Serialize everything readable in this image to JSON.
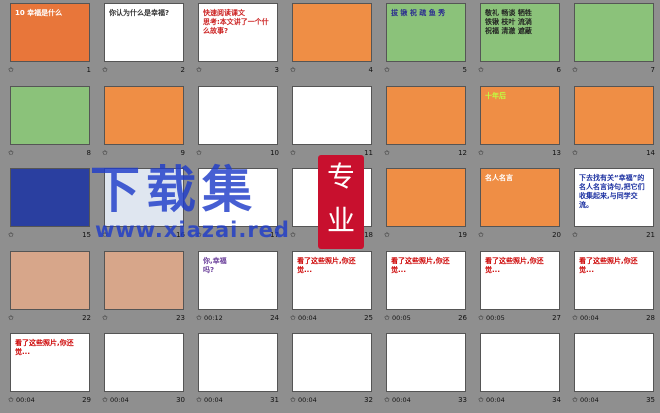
{
  "colors": {
    "background": "#8f8f8f",
    "watermark_blue": "#1e3cc8",
    "seal_red": "#c8102e"
  },
  "watermark": {
    "title": "下载集",
    "seal": "专业",
    "url": "www.xiazai.red"
  },
  "slides": [
    {
      "number": "1",
      "time": "",
      "has_time": false,
      "bg": "#e8763a",
      "text": "10 幸福是什么",
      "text_color": "#ffffff"
    },
    {
      "number": "2",
      "time": "",
      "has_time": false,
      "bg": "#ffffff",
      "text": "你认为什么是幸福?",
      "text_color": "#333333"
    },
    {
      "number": "3",
      "time": "",
      "has_time": false,
      "bg": "#ffffff",
      "text": "快速阅读课文\n思考:本文讲了一个什么故事?",
      "text_color": "#cc2222"
    },
    {
      "number": "4",
      "time": "",
      "has_time": false,
      "bg": "#ef8e45",
      "text": "",
      "text_color": "#ffffff"
    },
    {
      "number": "5",
      "time": "",
      "has_time": false,
      "bg": "#8bc27a",
      "text": "拔 锹 祝 疏 鱼 秀",
      "text_color": "#2a2a90"
    },
    {
      "number": "6",
      "time": "",
      "has_time": false,
      "bg": "#8bc27a",
      "text": "敬礼 畅谈 牺牲\n铁锹 枝叶 流淌\n祝福 清澈 遮蔽",
      "text_color": "#222222"
    },
    {
      "number": "7",
      "time": "",
      "has_time": false,
      "bg": "#8bc27a",
      "text": "",
      "text_color": "#222222"
    },
    {
      "number": "8",
      "time": "",
      "has_time": false,
      "bg": "#8bc27a",
      "text": "",
      "text_color": "#222222"
    },
    {
      "number": "9",
      "time": "",
      "has_time": false,
      "bg": "#ef8e45",
      "text": "",
      "text_color": "#ffffff"
    },
    {
      "number": "10",
      "time": "",
      "has_time": false,
      "bg": "#ffffff",
      "text": "",
      "text_color": "#222222"
    },
    {
      "number": "11",
      "time": "",
      "has_time": false,
      "bg": "#ffffff",
      "text": "",
      "text_color": "#222222"
    },
    {
      "number": "12",
      "time": "",
      "has_time": false,
      "bg": "#ef8e45",
      "text": "",
      "text_color": "#ffffff"
    },
    {
      "number": "13",
      "time": "",
      "has_time": false,
      "bg": "#ef8e45",
      "text": "十年后",
      "text_color": "#c0ff40"
    },
    {
      "number": "14",
      "time": "",
      "has_time": false,
      "bg": "#ef8e45",
      "text": "",
      "text_color": "#ffffff"
    },
    {
      "number": "15",
      "time": "",
      "has_time": false,
      "bg": "#2a3fa0",
      "text": "",
      "text_color": "#ffff66"
    },
    {
      "number": "16",
      "time": "",
      "has_time": false,
      "bg": "#dfe6f0",
      "text": "",
      "text_color": "#222222"
    },
    {
      "number": "17",
      "time": "",
      "has_time": false,
      "bg": "#ffffff",
      "text": "",
      "text_color": "#222222"
    },
    {
      "number": "18",
      "time": "",
      "has_time": false,
      "bg": "#ffffff",
      "text": "",
      "text_color": "#222222"
    },
    {
      "number": "19",
      "time": "",
      "has_time": false,
      "bg": "#ef8e45",
      "text": "",
      "text_color": "#ffffff"
    },
    {
      "number": "20",
      "time": "",
      "has_time": false,
      "bg": "#ef8e45",
      "text": "名人名言",
      "text_color": "#ffffff"
    },
    {
      "number": "21",
      "time": "",
      "has_time": false,
      "bg": "#ffffff",
      "text": "下去找有关“幸福”的名人名言诗句,把它们收集起来,与同学交流。",
      "text_color": "#1a2fa0"
    },
    {
      "number": "22",
      "time": "",
      "has_time": false,
      "bg": "#d7a68a",
      "text": "",
      "text_color": "#ffffff"
    },
    {
      "number": "23",
      "time": "",
      "has_time": false,
      "bg": "#d7a68a",
      "text": "",
      "text_color": "#ffffff"
    },
    {
      "number": "24",
      "time": "00:12",
      "has_time": true,
      "bg": "#ffffff",
      "text": "你,幸福\n吗?",
      "text_color": "#6a3f9a"
    },
    {
      "number": "25",
      "time": "00:04",
      "has_time": true,
      "bg": "#ffffff",
      "text": "看了这些照片,你还觉...",
      "text_color": "#cc0000"
    },
    {
      "number": "26",
      "time": "00:05",
      "has_time": true,
      "bg": "#ffffff",
      "text": "看了这些照片,你还觉...",
      "text_color": "#cc0000"
    },
    {
      "number": "27",
      "time": "00:05",
      "has_time": true,
      "bg": "#ffffff",
      "text": "看了这些照片,你还觉...",
      "text_color": "#cc0000"
    },
    {
      "number": "28",
      "time": "00:04",
      "has_time": true,
      "bg": "#ffffff",
      "text": "看了这些照片,你还觉...",
      "text_color": "#cc0000"
    },
    {
      "number": "29",
      "time": "00:04",
      "has_time": true,
      "bg": "#ffffff",
      "text": "看了这些照片,你还觉...",
      "text_color": "#cc0000"
    },
    {
      "number": "30",
      "time": "00:04",
      "has_time": true,
      "bg": "#ffffff",
      "text": "",
      "text_color": "#222222"
    },
    {
      "number": "31",
      "time": "00:04",
      "has_time": true,
      "bg": "#ffffff",
      "text": "",
      "text_color": "#222222"
    },
    {
      "number": "32",
      "time": "00:04",
      "has_time": true,
      "bg": "#ffffff",
      "text": "",
      "text_color": "#222222"
    },
    {
      "number": "33",
      "time": "00:04",
      "has_time": true,
      "bg": "#ffffff",
      "text": "",
      "text_color": "#222222"
    },
    {
      "number": "34",
      "time": "00:04",
      "has_time": true,
      "bg": "#ffffff",
      "text": "",
      "text_color": "#222222"
    },
    {
      "number": "35",
      "time": "00:04",
      "has_time": true,
      "bg": "#ffffff",
      "text": "",
      "text_color": "#222222"
    }
  ]
}
